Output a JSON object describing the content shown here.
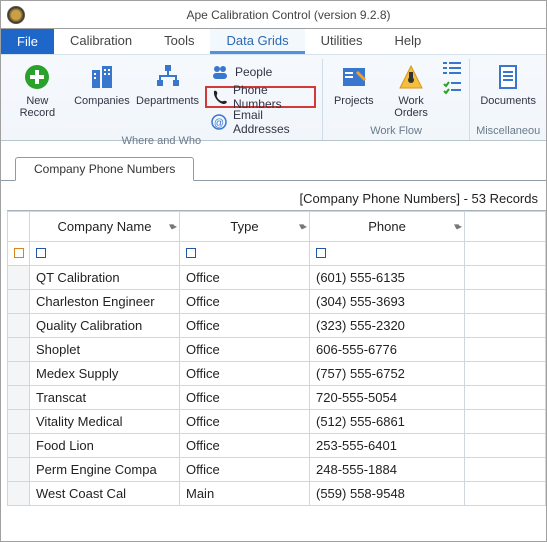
{
  "app": {
    "title": "Ape Calibration Control (version 9.2.8)"
  },
  "menus": {
    "file": "File",
    "tabs": [
      "Calibration",
      "Tools",
      "Data Grids",
      "Utilities",
      "Help"
    ],
    "active_index": 2
  },
  "ribbon": {
    "group_where": {
      "label": "Where and Who",
      "new_record": "New Record",
      "companies": "Companies",
      "departments": "Departments",
      "people": "People",
      "phone_numbers": "Phone Numbers",
      "email_addresses": "Email Addresses"
    },
    "group_workflow": {
      "label": "Work Flow",
      "projects": "Projects",
      "work_orders": "Work Orders"
    },
    "group_misc": {
      "label": "Miscellaneou",
      "documents": "Documents"
    }
  },
  "summary": "[Company Phone Numbers] - 53 Records",
  "doc_tab": "Company Phone Numbers",
  "columns": {
    "name": "Company Name",
    "type": "Type",
    "phone": "Phone"
  },
  "rows": [
    {
      "name": "QT Calibration",
      "type": "Office",
      "phone": "(601) 555-6135"
    },
    {
      "name": "Charleston Engineer",
      "type": "Office",
      "phone": "(304) 555-3693"
    },
    {
      "name": "Quality Calibration",
      "type": "Office",
      "phone": "(323) 555-2320"
    },
    {
      "name": "Shoplet",
      "type": "Office",
      "phone": "606-555-6776"
    },
    {
      "name": "Medex Supply",
      "type": "Office",
      "phone": "(757) 555-6752"
    },
    {
      "name": "Transcat",
      "type": "Office",
      "phone": "720-555-5054"
    },
    {
      "name": "Vitality Medical",
      "type": "Office",
      "phone": "(512) 555-6861"
    },
    {
      "name": "Food Lion",
      "type": "Office",
      "phone": "253-555-6401"
    },
    {
      "name": "Perm Engine Compa",
      "type": "Office",
      "phone": "248-555-1884"
    },
    {
      "name": "West Coast Cal",
      "type": "Main",
      "phone": "(559) 558-9548"
    }
  ]
}
